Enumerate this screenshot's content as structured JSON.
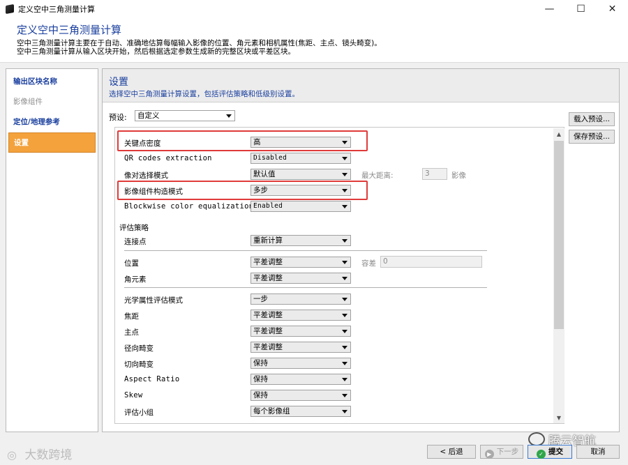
{
  "window": {
    "title": "定义空中三角测量计算",
    "controls": {
      "minimize": "—",
      "maximize": "☐",
      "close": "✕"
    }
  },
  "header": {
    "title": "定义空中三角测量计算",
    "desc1": "空中三角测量计算主要在于自动、准确地估算每幅输入影像的位置、角元素和相机属性(焦距、主点、镜头畸变)。",
    "desc2": "空中三角测量计算从输入区块开始，然后根据选定参数生成新的完整区块或平差区块。"
  },
  "sidebar": {
    "items": [
      {
        "label": "输出区块名称"
      },
      {
        "label": "影像组件"
      },
      {
        "label": "定位/地理参考"
      },
      {
        "label": "设置"
      }
    ]
  },
  "main": {
    "title": "设置",
    "subtitle": "选择空中三角测量计算设置，包括评估策略和低级别设置。",
    "preset_label": "预设:",
    "preset_value": "自定义",
    "load_preset": "载入预设...",
    "save_preset": "保存预设..."
  },
  "settings": {
    "keypoint_density": {
      "label": "关键点密度",
      "value": "高"
    },
    "qr_codes": {
      "label": "QR codes extraction",
      "value": "Disabled"
    },
    "pair_selection": {
      "label": "像对选择模式",
      "value": "默认值"
    },
    "max_distance": {
      "label": "最大距离:",
      "value": "3",
      "unit": "影像"
    },
    "component_mode": {
      "label": "影像组件构造模式",
      "value": "多步"
    },
    "color_eq": {
      "label": "Blockwise color equalization",
      "value": "Enabled"
    },
    "strategy_title": "评估策略",
    "tie_points": {
      "label": "连接点",
      "value": "重新计算"
    },
    "position": {
      "label": "位置",
      "value": "平差调整"
    },
    "tolerance": {
      "label": "容差",
      "value": "0"
    },
    "rotation": {
      "label": "角元素",
      "value": "平差调整"
    },
    "optical_mode": {
      "label": "光学属性评估模式",
      "value": "一步"
    },
    "focal": {
      "label": "焦距",
      "value": "平差调整"
    },
    "principal": {
      "label": "主点",
      "value": "平差调整"
    },
    "radial": {
      "label": "径向畸变",
      "value": "平差调整"
    },
    "tangential": {
      "label": "切向畸变",
      "value": "保持"
    },
    "aspect": {
      "label": "Aspect Ratio",
      "value": "保持"
    },
    "skew": {
      "label": "Skew",
      "value": "保持"
    },
    "group": {
      "label": "评估小组",
      "value": "每个影像组"
    }
  },
  "footer": {
    "back": "后退",
    "next": "下一步",
    "submit": "提交",
    "cancel": "取消"
  },
  "watermarks": {
    "left": "大数跨境",
    "right": "腾云智航"
  },
  "colors": {
    "accent": "#1a3f9e",
    "active": "#f4a23c",
    "highlight": "#e03a3a"
  }
}
